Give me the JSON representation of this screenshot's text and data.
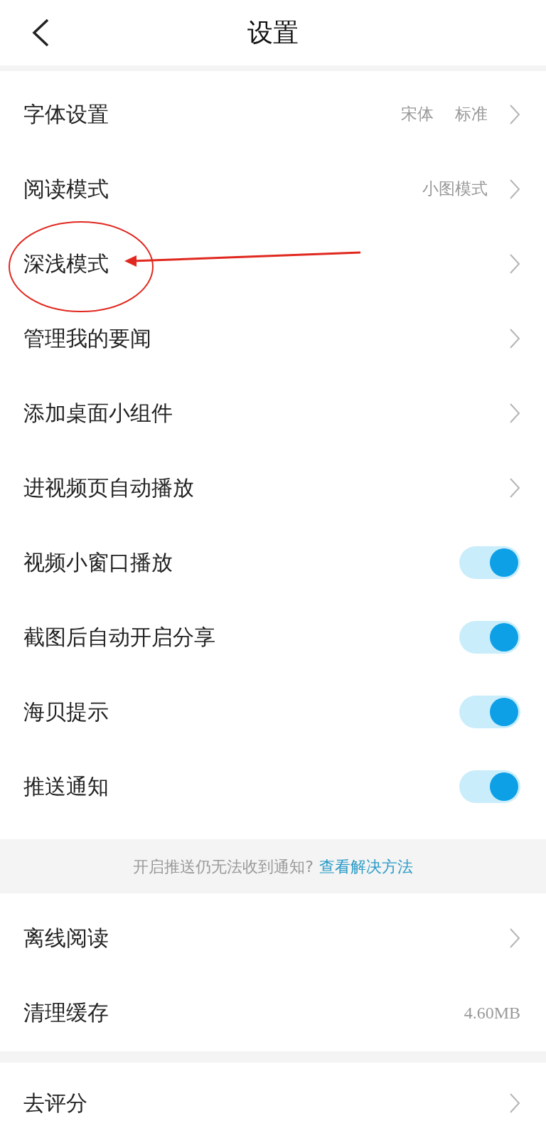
{
  "header": {
    "title": "设置"
  },
  "rows": [
    {
      "kind": "nav",
      "label": "字体设置",
      "values": [
        "宋体",
        "标准"
      ]
    },
    {
      "kind": "nav",
      "label": "阅读模式",
      "values": [
        "小图模式"
      ]
    },
    {
      "kind": "nav",
      "label": "深浅模式"
    },
    {
      "kind": "nav",
      "label": "管理我的要闻"
    },
    {
      "kind": "nav",
      "label": "添加桌面小组件"
    },
    {
      "kind": "nav",
      "label": "进视频页自动播放"
    },
    {
      "kind": "toggle",
      "label": "视频小窗口播放",
      "on": true
    },
    {
      "kind": "toggle",
      "label": "截图后自动开启分享",
      "on": true
    },
    {
      "kind": "toggle",
      "label": "海贝提示",
      "on": true
    },
    {
      "kind": "toggle",
      "label": "推送通知",
      "on": true
    }
  ],
  "notice": {
    "text": "开启推送仍无法收到通知?",
    "link": "查看解决方法"
  },
  "rows2": [
    {
      "kind": "nav",
      "label": "离线阅读"
    },
    {
      "kind": "value",
      "label": "清理缓存",
      "values": [
        "4.60MB"
      ]
    }
  ],
  "rows3": [
    {
      "kind": "nav",
      "label": "去评分"
    }
  ]
}
